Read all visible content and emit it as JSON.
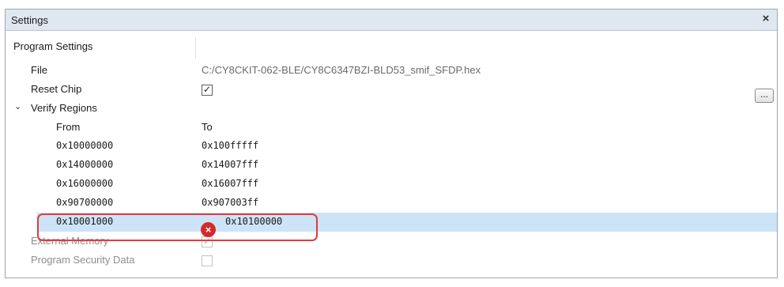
{
  "window": {
    "title": "Settings",
    "close_icon": "×"
  },
  "sections": {
    "program_settings": "Program Settings",
    "file_label": "File",
    "file_value": "C:/CY8CKIT-062-BLE/CY8C6347BZI-BLD53_smif_SFDP.hex",
    "browse_label": "...",
    "reset_chip_label": "Reset Chip",
    "reset_chip_checked": "✓",
    "verify_regions_label": "Verify Regions",
    "verify_chevron": "⌄",
    "from_header": "From",
    "to_header": "To",
    "external_memory_label": "External Memory",
    "external_memory_checked": "✓",
    "program_security_label": "Program Security Data"
  },
  "regions": [
    {
      "from": "0x10000000",
      "to": "0x100fffff"
    },
    {
      "from": "0x14000000",
      "to": "0x14007fff"
    },
    {
      "from": "0x16000000",
      "to": "0x16007fff"
    },
    {
      "from": "0x90700000",
      "to": "0x907003ff"
    },
    {
      "from": "0x10001000",
      "to": "0x10100000",
      "error": true
    }
  ],
  "error_icon": "×",
  "colors": {
    "titlebar": "#dfe7f1",
    "selected_row": "#cde3f7",
    "highlight_border": "#e23b3b",
    "error_icon": "#d32b2b"
  }
}
